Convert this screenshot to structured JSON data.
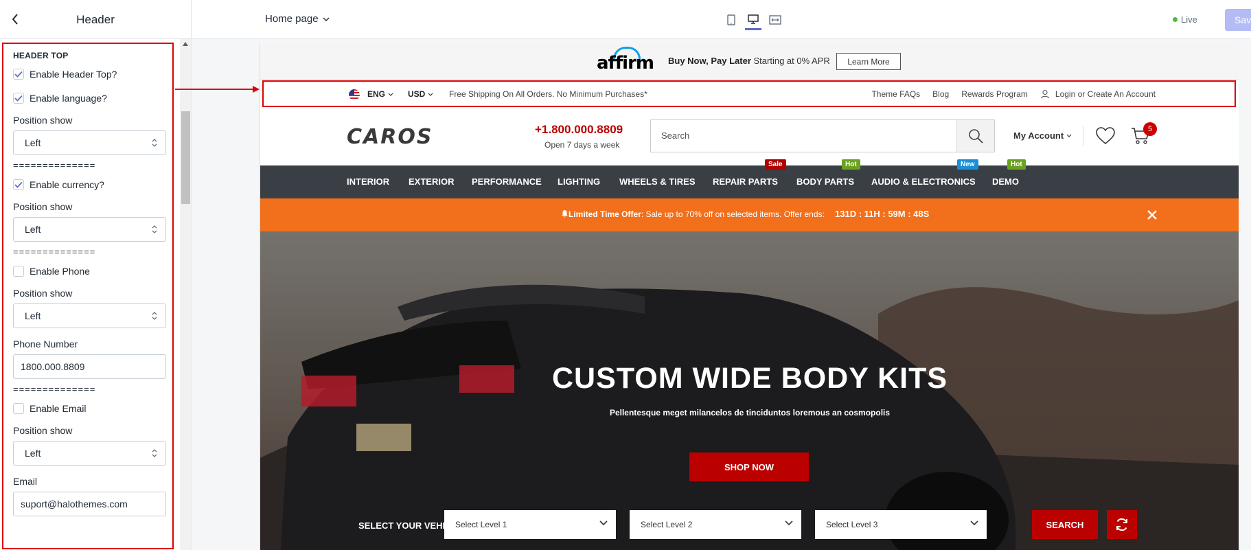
{
  "editor": {
    "section_title": "Header",
    "page_selector": "Home page",
    "live_label": "Live",
    "save_label": "Save"
  },
  "settings": {
    "heading": "HEADER TOP",
    "enable_header_top": "Enable Header Top?",
    "enable_language": "Enable language?",
    "position_show_1": "Position show",
    "position_1_value": "Left",
    "divider_1": "==============",
    "enable_currency": "Enable currency?",
    "position_show_2": "Position show",
    "position_2_value": "Left",
    "divider_2": "==============",
    "enable_phone": "Enable Phone",
    "position_show_3": "Position show",
    "position_3_value": "Left",
    "phone_number_label": "Phone Number",
    "phone_number_value": "1800.000.8809",
    "divider_3": "==============",
    "enable_email": "Enable Email",
    "position_show_4": "Position show",
    "position_4_value": "Left",
    "email_label": "Email",
    "email_value": "suport@halothemes.com",
    "checked": {
      "header_top": true,
      "language": true,
      "currency": true,
      "phone": false,
      "email": false
    }
  },
  "store": {
    "affirm_logo": "affirm",
    "affirm_bold": "Buy Now, Pay Later",
    "affirm_rest": " Starting at 0% APR",
    "learn_more": "Learn More",
    "lang": "ENG",
    "currency": "USD",
    "shipping_note": "Free Shipping On All Orders. No Minimum Purchases*",
    "top_links": [
      "Theme FAQs",
      "Blog",
      "Rewards Program",
      "Login or Create An Account"
    ],
    "logo": "CAROS",
    "phone": "+1.800.000.8809",
    "hours": "Open 7 days a week",
    "search_placeholder": "Search",
    "my_account": "My Account",
    "cart_count": "5",
    "menu": [
      {
        "label": "INTERIOR"
      },
      {
        "label": "EXTERIOR"
      },
      {
        "label": "PERFORMANCE"
      },
      {
        "label": "LIGHTING"
      },
      {
        "label": "WHEELS & TIRES"
      },
      {
        "label": "REPAIR PARTS",
        "tag": "Sale"
      },
      {
        "label": "BODY PARTS",
        "tag": "Hot"
      },
      {
        "label": "AUDIO & ELECTRONICS",
        "tag": "New"
      },
      {
        "label": "DEMO",
        "tag": "Hot"
      }
    ],
    "offer_bold": "Limited Time Offer",
    "offer_rest": ": Sale up to 70% off on selected items. Offer ends:",
    "offer_countdown": "131D : 11H : 59M : 48S",
    "hero_title": "CUSTOM WIDE BODY KITS",
    "hero_subtitle": "Pellentesque meget milancelos de tinciduntos loremous an cosmopolis",
    "shop_now": "SHOP NOW",
    "select_vehicle": "SELECT YOUR VEHICLE",
    "level_1": "Select Level 1",
    "level_2": "Select Level 2",
    "level_3": "Select Level 3",
    "vehicle_search": "SEARCH"
  },
  "colors": {
    "accent_red": "#b80000",
    "offer_orange": "#f26f1b",
    "menu_dark": "#3a3f45",
    "tag_sale": "#b00000",
    "tag_hot": "#6aa120",
    "tag_new": "#1a8fd8",
    "save_disabled": "#b3bcf5"
  }
}
